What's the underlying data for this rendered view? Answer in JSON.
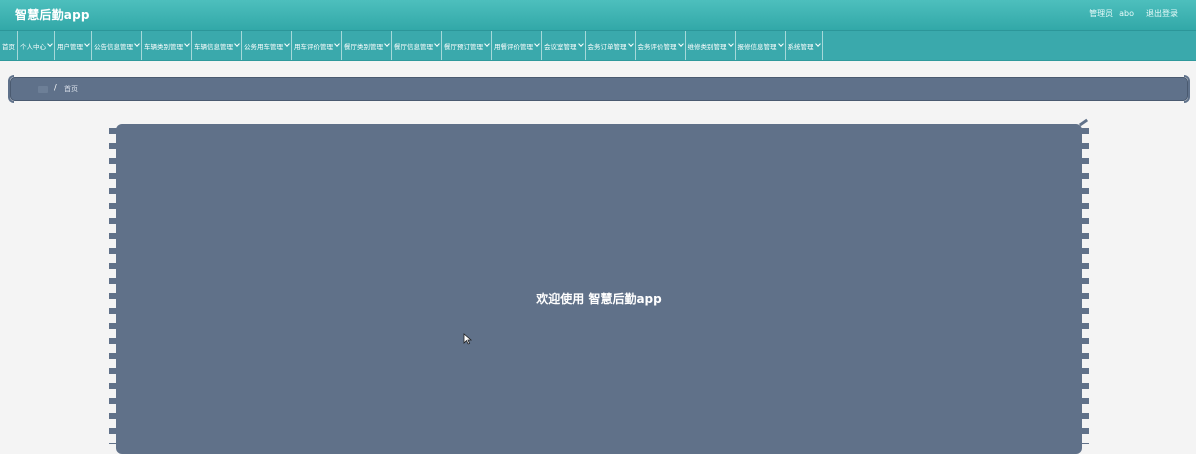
{
  "header": {
    "app_title": "智慧后勤app",
    "user_role": "管理员",
    "user_name": "abo",
    "logout_label": "退出登录"
  },
  "nav": {
    "items": [
      {
        "label": "首页",
        "dropdown": false
      },
      {
        "label": "个人中心",
        "dropdown": true
      },
      {
        "label": "用户管理",
        "dropdown": true
      },
      {
        "label": "公告信息管理",
        "dropdown": true
      },
      {
        "label": "车辆类别管理",
        "dropdown": true
      },
      {
        "label": "车辆信息管理",
        "dropdown": true
      },
      {
        "label": "公务用车管理",
        "dropdown": true
      },
      {
        "label": "用车评价管理",
        "dropdown": true
      },
      {
        "label": "餐厅类别管理",
        "dropdown": true
      },
      {
        "label": "餐厅信息管理",
        "dropdown": true
      },
      {
        "label": "餐厅预订管理",
        "dropdown": true
      },
      {
        "label": "用餐评价管理",
        "dropdown": true
      },
      {
        "label": "会议室管理",
        "dropdown": true
      },
      {
        "label": "会务订单管理",
        "dropdown": true
      },
      {
        "label": "会务评价管理",
        "dropdown": true
      },
      {
        "label": "维修类别管理",
        "dropdown": true
      },
      {
        "label": "报修信息管理",
        "dropdown": true
      },
      {
        "label": "系统管理",
        "dropdown": true
      }
    ]
  },
  "breadcrumb": {
    "separator": "/",
    "current": "首页"
  },
  "main": {
    "welcome_text": "欢迎使用 智慧后勤app"
  },
  "colors": {
    "header_teal": "#3aa9ac",
    "panel_slate": "#607189",
    "page_bg": "#f4f4f4"
  }
}
